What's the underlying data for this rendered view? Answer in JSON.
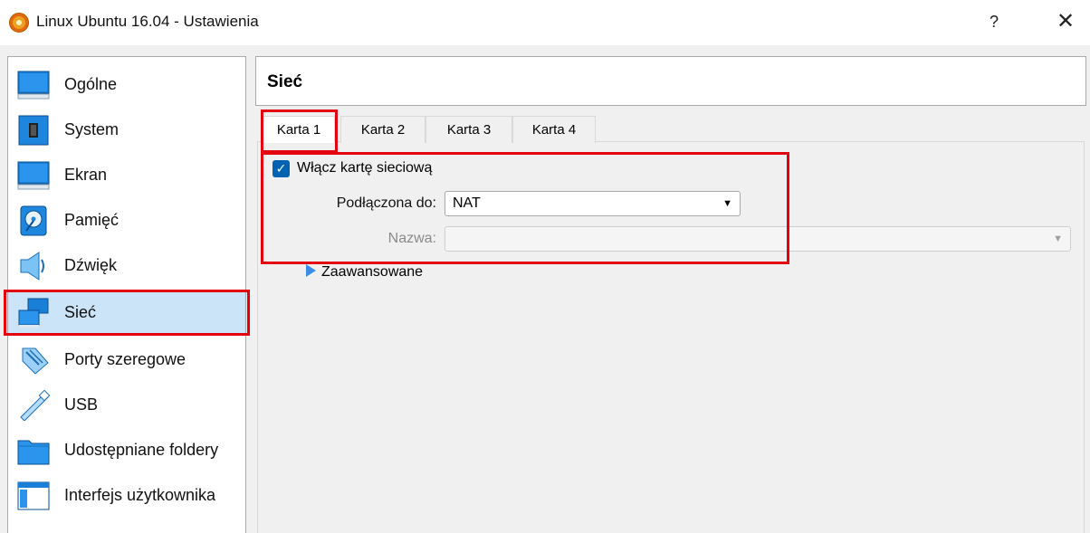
{
  "window": {
    "title": "Linux Ubuntu 16.04 - Ustawienia",
    "help_label": "?",
    "close_label": "✕"
  },
  "sidebar": {
    "items": [
      {
        "label": "Ogólne",
        "icon": "general-monitor-icon"
      },
      {
        "label": "System",
        "icon": "system-chip-icon"
      },
      {
        "label": "Ekran",
        "icon": "display-icon"
      },
      {
        "label": "Pamięć",
        "icon": "storage-disk-icon"
      },
      {
        "label": "Dźwięk",
        "icon": "audio-speaker-icon"
      },
      {
        "label": "Sieć",
        "icon": "network-icon",
        "selected": true
      },
      {
        "label": "Porty szeregowe",
        "icon": "serial-port-icon"
      },
      {
        "label": "USB",
        "icon": "usb-icon"
      },
      {
        "label": "Udostępniane foldery",
        "icon": "shared-folder-icon"
      },
      {
        "label": "Interfejs użytkownika",
        "icon": "user-interface-icon"
      }
    ]
  },
  "main": {
    "section_title": "Sieć",
    "tabs": [
      {
        "label": "Karta 1",
        "active": true
      },
      {
        "label": "Karta 2"
      },
      {
        "label": "Karta 3"
      },
      {
        "label": "Karta 4"
      }
    ],
    "enable_adapter": {
      "label": "Włącz kartę sieciową",
      "checked": true
    },
    "attached_to": {
      "label": "Podłączona do:",
      "value": "NAT"
    },
    "name": {
      "label": "Nazwa:",
      "value": "",
      "disabled": true
    },
    "advanced_label": "Zaawansowane"
  },
  "colors": {
    "highlight": "#e3000f",
    "selection": "#cce4f7",
    "accent": "#0063b1"
  }
}
